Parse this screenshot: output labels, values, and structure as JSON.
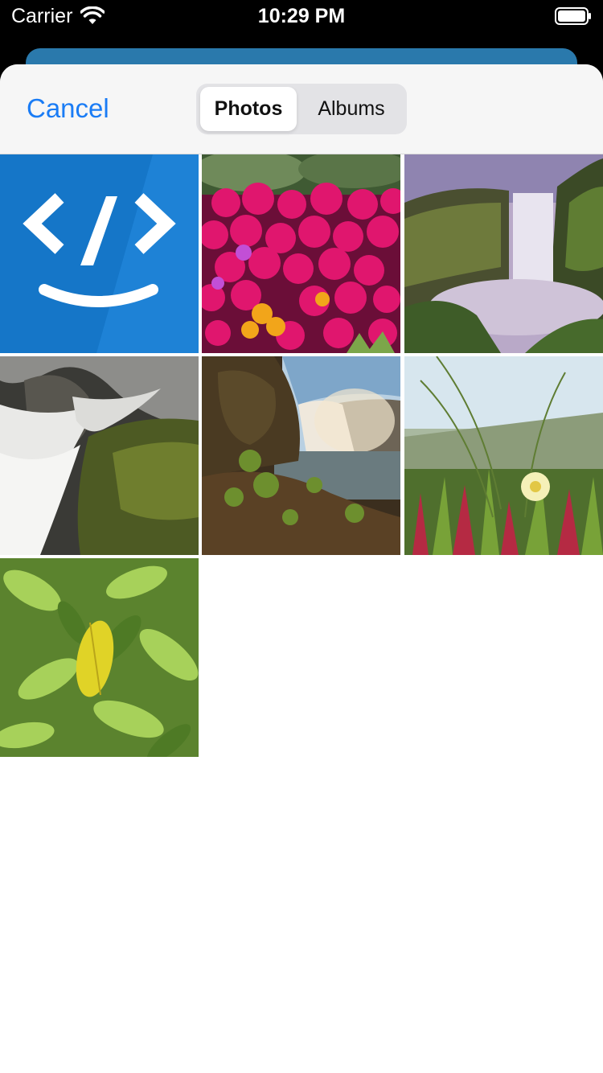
{
  "status_bar": {
    "carrier": "Carrier",
    "time": "10:29 PM"
  },
  "nav": {
    "cancel_label": "Cancel",
    "segments": [
      {
        "label": "Photos",
        "selected": true
      },
      {
        "label": "Albums",
        "selected": false
      }
    ]
  },
  "colors": {
    "accent": "#1a7cf5",
    "app_icon_blue": "#1576c8",
    "underlay": "#2a79ac"
  },
  "photos": [
    {
      "subject": "code-logo"
    },
    {
      "subject": "pink-flowers"
    },
    {
      "subject": "waterfall-cliff"
    },
    {
      "subject": "waterfall-rocks"
    },
    {
      "subject": "waterfall-moss"
    },
    {
      "subject": "beach-grass-flower"
    },
    {
      "subject": "green-leaves"
    }
  ]
}
